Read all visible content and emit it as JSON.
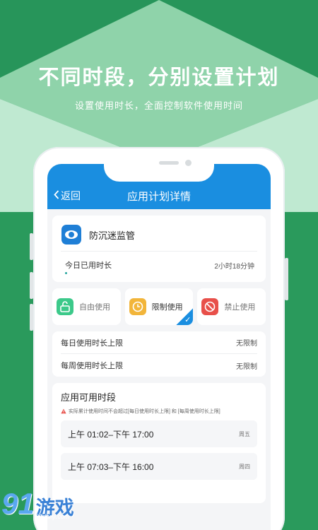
{
  "promo": {
    "headline": "不同时段，分别设置计划",
    "subline": "设置使用时长，全面控制软件使用时间"
  },
  "navbar": {
    "back_label": "返回",
    "title": "应用计划详情"
  },
  "app": {
    "name": "防沉迷监管",
    "today_label": "今日已用时长",
    "today_value": "2小时18分钟"
  },
  "modes": [
    {
      "label": "自由使用",
      "icon": "unlock-icon",
      "color": "#3cc98a",
      "selected": false
    },
    {
      "label": "限制使用",
      "icon": "clock-icon",
      "color": "#f2b53a",
      "selected": true
    },
    {
      "label": "禁止使用",
      "icon": "forbidden-icon",
      "color": "#e8504a",
      "selected": false
    }
  ],
  "limits": [
    {
      "label": "每日使用时长上限",
      "value": "无限制"
    },
    {
      "label": "每周使用时长上限",
      "value": "无限制"
    }
  ],
  "periods": {
    "title": "应用可用时段",
    "warning": "实际累计使用时间不会超过[每日使用时长上限] 和 [每周使用时长上限]",
    "items": [
      {
        "time": "上午 01:02–下午 17:00",
        "day": "周五"
      },
      {
        "time": "上午 07:03–下午 16:00",
        "day": "周四"
      }
    ]
  },
  "watermark": {
    "num": "91",
    "text": "游戏",
    "url": "91danji.com"
  },
  "colors": {
    "accent": "#1a8ee0",
    "bg_green": "#2a9a5c"
  }
}
